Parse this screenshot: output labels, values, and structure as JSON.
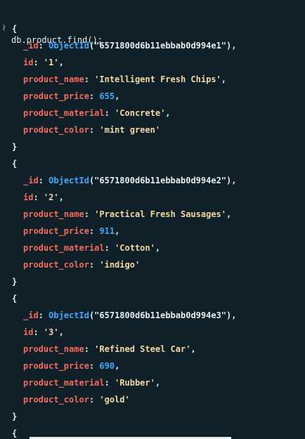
{
  "shell": {
    "prompt_glyph": "›",
    "output_glyph": "‹",
    "command": "db.product.find();"
  },
  "documents": [
    {
      "open": "{",
      "close": "}",
      "fields": [
        {
          "key": "_id",
          "fn": "ObjectId",
          "arg": "\"6571800d6b11ebbab0d994e1\""
        },
        {
          "key": "id",
          "str": "'1'"
        },
        {
          "key": "product_name",
          "str": "'Intelligent Fresh Chips'"
        },
        {
          "key": "product_price",
          "num": "655"
        },
        {
          "key": "product_material",
          "str": "'Concrete'"
        },
        {
          "key": "product_color",
          "str": "'mint green'"
        }
      ]
    },
    {
      "open": "{",
      "close": "}",
      "fields": [
        {
          "key": "_id",
          "fn": "ObjectId",
          "arg": "\"6571800d6b11ebbab0d994e2\""
        },
        {
          "key": "id",
          "str": "'2'"
        },
        {
          "key": "product_name",
          "str": "'Practical Fresh Sausages'"
        },
        {
          "key": "product_price",
          "num": "911"
        },
        {
          "key": "product_material",
          "str": "'Cotton'"
        },
        {
          "key": "product_color",
          "str": "'indigo'"
        }
      ]
    },
    {
      "open": "{",
      "close": "}",
      "fields": [
        {
          "key": "_id",
          "fn": "ObjectId",
          "arg": "\"6571800d6b11ebbab0d994e3\""
        },
        {
          "key": "id",
          "str": "'3'"
        },
        {
          "key": "product_name",
          "str": "'Refined Steel Car'"
        },
        {
          "key": "product_price",
          "num": "690"
        },
        {
          "key": "product_material",
          "str": "'Rubber'"
        },
        {
          "key": "product_color",
          "str": "'gold'"
        }
      ]
    },
    {
      "open": "{",
      "close": "",
      "fields": []
    }
  ],
  "colors": {
    "background": "#0f2028",
    "key": "#f26b5b",
    "function": "#3da9ff",
    "string": "#f3d9a1",
    "number": "#3da9ff",
    "text": "#e8edeb"
  }
}
